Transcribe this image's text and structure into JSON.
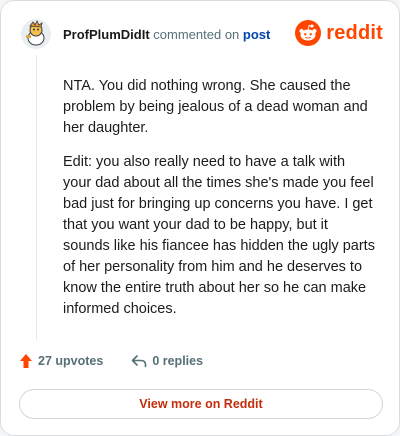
{
  "header": {
    "username": "ProfPlumDidIt",
    "action_text": "commented on",
    "target_link": "post",
    "brand": "reddit"
  },
  "comment": {
    "paragraphs": [
      "NTA. You did nothing wrong. She caused the problem by being jealous of a dead woman and her daughter.",
      "Edit: you also really need to have a talk with your dad about all the times she's made you feel bad just for bringing up concerns you have. I get that you want your dad to be happy, but it sounds like his fiancee has hidden the ugly parts of her personality from him and he deserves to know the entire truth about her so he can make informed choices."
    ]
  },
  "actions": {
    "upvotes": "27 upvotes",
    "replies": "0 replies"
  },
  "footer": {
    "view_more": "View more on Reddit"
  },
  "colors": {
    "accent": "#ff4500",
    "link": "#0045ac",
    "button_text": "#c42e0c"
  },
  "icons": {
    "avatar": "snoo-avatar-icon",
    "logo": "reddit-logo-icon",
    "upvote": "upvote-arrow-icon",
    "reply": "reply-arrow-icon"
  }
}
